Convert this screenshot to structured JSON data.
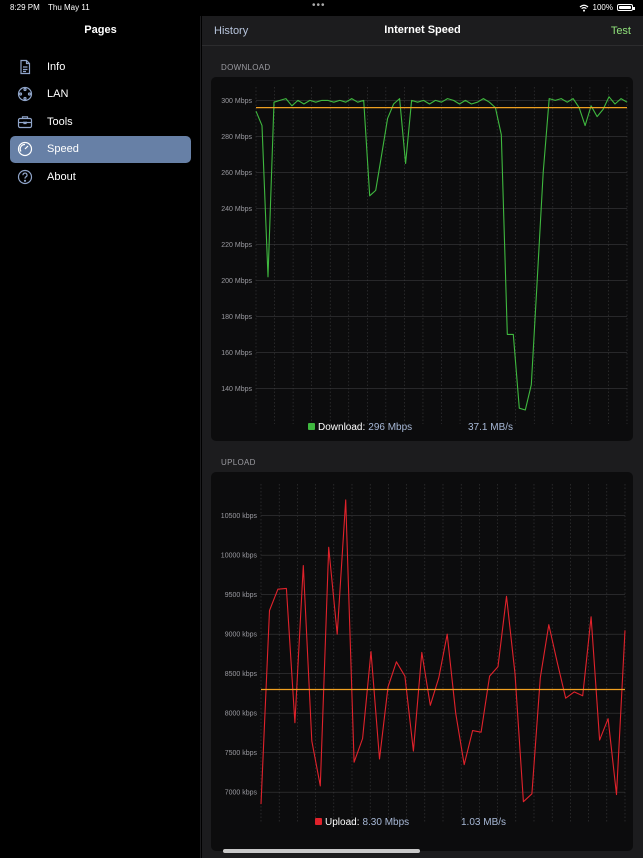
{
  "status_bar": {
    "time": "8:29 PM",
    "date": "Thu May 11",
    "battery": "100%",
    "wifi_icon": "wifi-icon",
    "battery_icon": "battery-icon"
  },
  "sidebar": {
    "title": "Pages",
    "items": [
      {
        "label": "Info",
        "icon": "document-icon",
        "active": false
      },
      {
        "label": "LAN",
        "icon": "network-icon",
        "active": false
      },
      {
        "label": "Tools",
        "icon": "toolbox-icon",
        "active": false
      },
      {
        "label": "Speed",
        "icon": "speedometer-icon",
        "active": true
      },
      {
        "label": "About",
        "icon": "question-circle-icon",
        "active": false
      }
    ]
  },
  "header": {
    "history_label": "History",
    "title": "Internet Speed",
    "test_label": "Test"
  },
  "colors": {
    "download_line": "#3fb83f",
    "upload_line": "#e0222b",
    "average_line": "#f0a020",
    "accent_active": "#6780a6",
    "value_text": "#a7b8d6"
  },
  "download": {
    "section_label": "DOWNLOAD",
    "legend_label": "Download:",
    "legend_value": "296 Mbps",
    "rate": "37.1 MB/s"
  },
  "upload": {
    "section_label": "UPLOAD",
    "legend_label": "Upload:",
    "legend_value": "8.30 Mbps",
    "rate": "1.03 MB/s"
  },
  "chart_data": [
    {
      "type": "line",
      "title": "",
      "ylabel": "",
      "y_unit": "Mbps",
      "ylim": [
        128,
        303
      ],
      "yticks": [
        140,
        160,
        180,
        200,
        220,
        240,
        260,
        280,
        300
      ],
      "ytick_labels": [
        "140 Mbps",
        "160 Mbps",
        "180 Mbps",
        "200 Mbps",
        "220 Mbps",
        "240 Mbps",
        "260 Mbps",
        "280 Mbps",
        "300 Mbps"
      ],
      "grid": true,
      "average": 296,
      "series": [
        {
          "name": "Download",
          "values": [
            294,
            286,
            202,
            299,
            300,
            301,
            297,
            300,
            298,
            300,
            299,
            300,
            300,
            299,
            300,
            299,
            301,
            299,
            300,
            247,
            250,
            270,
            290,
            298,
            301,
            265,
            300,
            299,
            300,
            298,
            300,
            299,
            301,
            300,
            298,
            300,
            298,
            299,
            301,
            299,
            296,
            281,
            170,
            170,
            129,
            128,
            142,
            200,
            260,
            301,
            300,
            301,
            299,
            301,
            296,
            286,
            297,
            291,
            295,
            302,
            298,
            301,
            299
          ]
        }
      ]
    },
    {
      "type": "line",
      "title": "",
      "ylabel": "",
      "y_unit": "kbps",
      "ylim": [
        6800,
        10800
      ],
      "yticks": [
        7000,
        7500,
        8000,
        8500,
        9000,
        9500,
        10000,
        10500
      ],
      "ytick_labels": [
        "7000 kbps",
        "7500 kbps",
        "8000 kbps",
        "8500 kbps",
        "9000 kbps",
        "9500 kbps",
        "10000 kbps",
        "10500 kbps"
      ],
      "grid": true,
      "average": 8300,
      "series": [
        {
          "name": "Upload",
          "values": [
            6850,
            9300,
            9570,
            9580,
            7880,
            9870,
            7650,
            7080,
            10100,
            9000,
            10700,
            7380,
            7680,
            8780,
            7420,
            8330,
            8650,
            8470,
            7520,
            8770,
            8100,
            8450,
            9000,
            8000,
            7350,
            7780,
            7760,
            8470,
            8590,
            9480,
            8500,
            6880,
            6980,
            8450,
            9120,
            8640,
            8190,
            8270,
            8220,
            9220,
            7660,
            7930,
            6970,
            9050
          ]
        }
      ]
    }
  ]
}
